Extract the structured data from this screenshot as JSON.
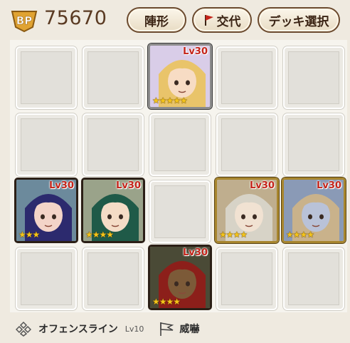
{
  "header": {
    "bp_label": "BP",
    "bp_value": "75670",
    "formation_label": "陣形",
    "swap_label": "交代",
    "deck_select_label": "デッキ選択"
  },
  "units": [
    {
      "id": "u1",
      "level": "Lv30",
      "stars": "★★★★★",
      "hair": "#e9c46a",
      "skin": "#f7dcc4",
      "bg": "#d9cde8"
    },
    {
      "id": "u2",
      "level": "Lv30",
      "stars": "★★★",
      "hair": "#2c2a6e",
      "skin": "#f3d4c8",
      "bg": "#6c8a9c"
    },
    {
      "id": "u3",
      "level": "Lv30",
      "stars": "★★★★",
      "hair": "#1f5a48",
      "skin": "#f4dcc6",
      "bg": "#9aa38a"
    },
    {
      "id": "u4",
      "level": "Lv30",
      "stars": "★★★★",
      "hair": "#d7d3c7",
      "skin": "#f1e2d2",
      "bg": "#bfae8e"
    },
    {
      "id": "u5",
      "level": "Lv30",
      "stars": "★★★★",
      "hair": "#c9b28b",
      "skin": "#b9c2d8",
      "bg": "#8a9ab6"
    },
    {
      "id": "u6",
      "level": "Lv30",
      "stars": "★★★★",
      "hair": "#8c1f1a",
      "skin": "#7c5a38",
      "bg": "#4a4a36"
    }
  ],
  "footer": {
    "skill_name": "オフェンスライン",
    "skill_level": "Lv10",
    "tactic_name": "威嚇"
  },
  "colors": {
    "background": "#efeae0",
    "button_border": "#6b4a2e",
    "level_text": "#c4241a",
    "stars": "#f4c419"
  }
}
